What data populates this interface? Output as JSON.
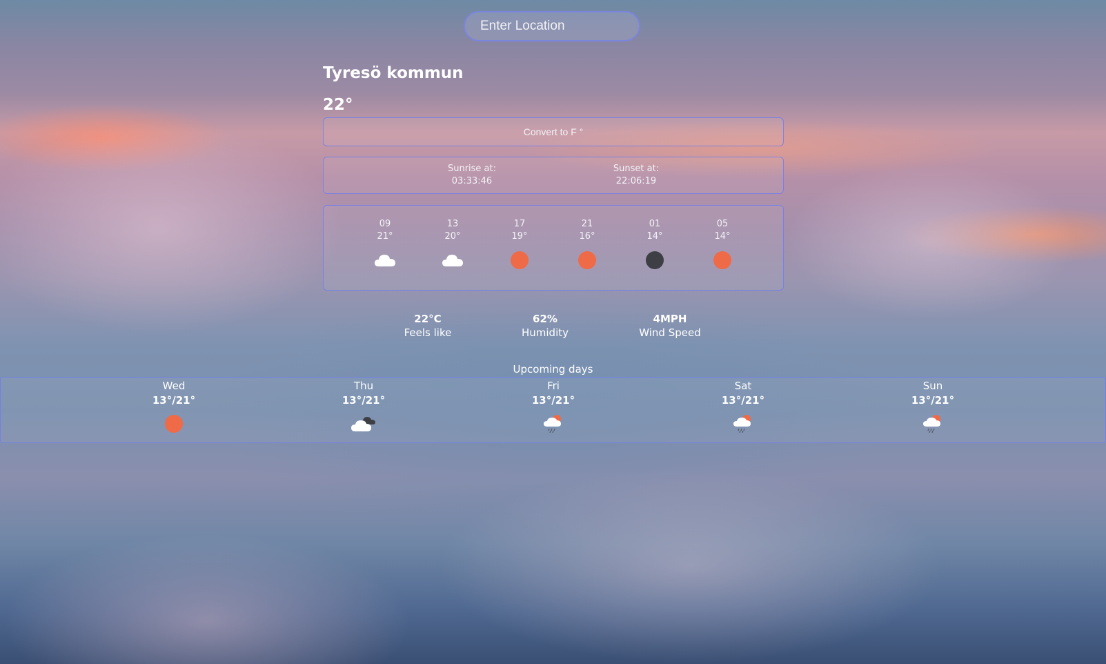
{
  "search": {
    "placeholder": "Enter Location"
  },
  "location": {
    "name": "Tyresö kommun",
    "temperature": "22°"
  },
  "convert_button": {
    "label": "Convert to F °"
  },
  "sun": {
    "sunrise_label": "Sunrise at:",
    "sunrise_time": "03:33:46",
    "sunset_label": "Sunset at:",
    "sunset_time": "22:06:19"
  },
  "hourly": [
    {
      "hour": "09",
      "temp": "21°",
      "icon": "cloud-icon"
    },
    {
      "hour": "13",
      "temp": "20°",
      "icon": "cloud-icon"
    },
    {
      "hour": "17",
      "temp": "19°",
      "icon": "sun-icon"
    },
    {
      "hour": "21",
      "temp": "16°",
      "icon": "sun-icon"
    },
    {
      "hour": "01",
      "temp": "14°",
      "icon": "moon-icon"
    },
    {
      "hour": "05",
      "temp": "14°",
      "icon": "sun-icon"
    }
  ],
  "stats": {
    "feels_like_value": "22°C",
    "feels_like_label": "Feels like",
    "humidity_value": "62%",
    "humidity_label": "Humidity",
    "wind_value": "4MPH",
    "wind_label": "Wind Speed"
  },
  "upcoming": {
    "title": "Upcoming days",
    "days": [
      {
        "name": "Wed",
        "range": "13°/21°",
        "icon": "sun-icon"
      },
      {
        "name": "Thu",
        "range": "13°/21°",
        "icon": "dark-clouds-icon"
      },
      {
        "name": "Fri",
        "range": "13°/21°",
        "icon": "sun-rain-cloud-icon"
      },
      {
        "name": "Sat",
        "range": "13°/21°",
        "icon": "sun-rain-cloud-icon"
      },
      {
        "name": "Sun",
        "range": "13°/21°",
        "icon": "sun-rain-cloud-icon"
      }
    ]
  },
  "colors": {
    "accent_border": "#6e7df0",
    "sun": "#ef6a47",
    "moon": "#3d3f45"
  }
}
